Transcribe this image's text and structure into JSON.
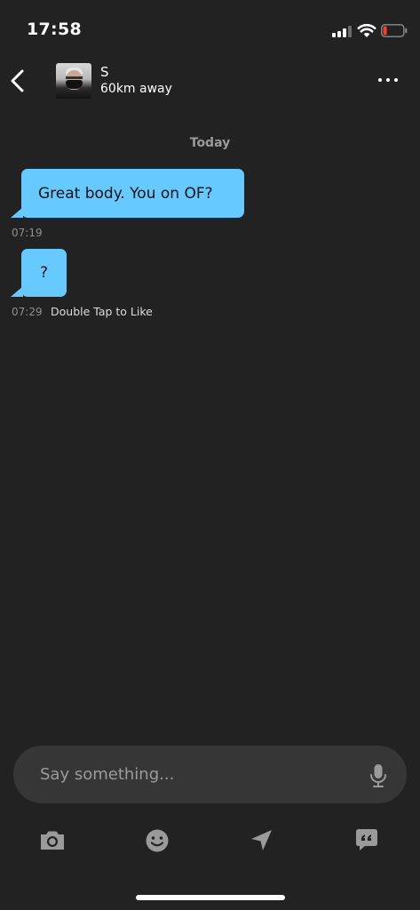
{
  "status_bar": {
    "time": "17:58",
    "signal_icon": "cellular-signal-icon",
    "wifi_icon": "wifi-icon",
    "battery_icon": "battery-low-icon",
    "battery_color": "#ff3b30"
  },
  "header": {
    "back_icon": "chevron-left-icon",
    "contact_name": "S",
    "contact_distance": "60km away",
    "more_icon": "more-horizontal-icon"
  },
  "conversation": {
    "date_divider": "Today",
    "messages": [
      {
        "text": "Great body.  You on OF?",
        "time": "07:19"
      },
      {
        "text": "?",
        "time": "07:29"
      }
    ],
    "like_hint": "Double Tap to Like",
    "bubble_color": "#66c9ff"
  },
  "composer": {
    "placeholder": "Say something...",
    "mic_icon": "microphone-icon"
  },
  "toolbar": {
    "items": [
      {
        "icon": "camera-icon"
      },
      {
        "icon": "emoji-icon"
      },
      {
        "icon": "location-arrow-icon"
      },
      {
        "icon": "quick-phrases-icon"
      }
    ],
    "icon_color": "#9a9a9a"
  },
  "colors": {
    "background": "#222222",
    "input_background": "#363636"
  }
}
